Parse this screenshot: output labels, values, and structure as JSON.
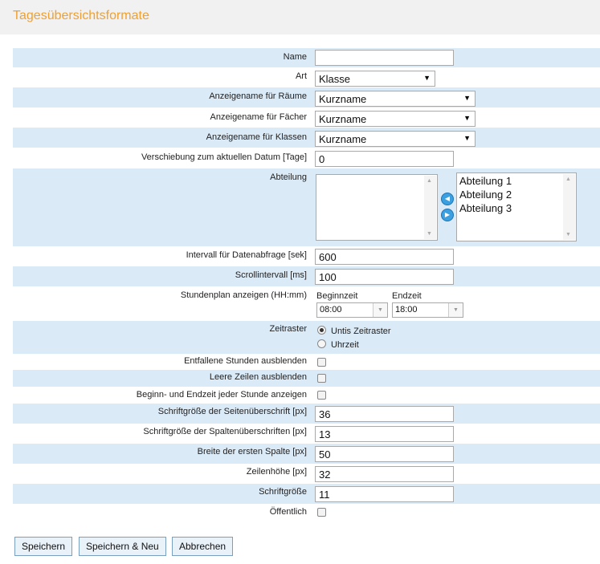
{
  "page": {
    "title": "Tagesübersichtsformate"
  },
  "fields": {
    "name": {
      "label": "Name",
      "value": ""
    },
    "art": {
      "label": "Art",
      "value": "Klasse"
    },
    "raeume": {
      "label": "Anzeigename für Räume",
      "value": "Kurzname"
    },
    "faecher": {
      "label": "Anzeigename für Fächer",
      "value": "Kurzname"
    },
    "klassen": {
      "label": "Anzeigename für Klassen",
      "value": "Kurzname"
    },
    "verschiebung": {
      "label": "Verschiebung zum aktuellen Datum [Tage]",
      "value": "0"
    },
    "abteilung": {
      "label": "Abteilung",
      "selected": [],
      "available": [
        "Abteilung 1",
        "Abteilung 2",
        "Abteilung 3"
      ]
    },
    "intervall": {
      "label": "Intervall für Datenabfrage [sek]",
      "value": "600"
    },
    "scrollintervall": {
      "label": "Scrollintervall [ms]",
      "value": "100"
    },
    "stundenplan": {
      "label": "Stundenplan anzeigen (HH:mm)",
      "begin_label": "Beginnzeit",
      "begin_value": "08:00",
      "end_label": "Endzeit",
      "end_value": "18:00"
    },
    "zeitraster": {
      "label": "Zeitraster",
      "options": [
        "Untis Zeitraster",
        "Uhrzeit"
      ],
      "selected": "Untis Zeitraster"
    },
    "entfallene": {
      "label": "Entfallene Stunden ausblenden",
      "checked": false
    },
    "leere": {
      "label": "Leere Zeilen ausblenden",
      "checked": false
    },
    "beginn_end": {
      "label": "Beginn- und Endzeit jeder Stunde anzeigen",
      "checked": false
    },
    "schrift_seite": {
      "label": "Schriftgröße der Seitenüberschrift [px]",
      "value": "36"
    },
    "schrift_spalte": {
      "label": "Schriftgröße der Spaltenüberschriften [px]",
      "value": "13"
    },
    "breite": {
      "label": "Breite der ersten Spalte [px]",
      "value": "50"
    },
    "zeilenhoehe": {
      "label": "Zeilenhöhe [px]",
      "value": "32"
    },
    "schriftgroesse": {
      "label": "Schriftgröße",
      "value": "11"
    },
    "oeffentlich": {
      "label": "Öffentlich",
      "checked": false
    }
  },
  "buttons": {
    "save": "Speichern",
    "save_new": "Speichern & Neu",
    "cancel": "Abbrechen"
  },
  "colors": {
    "title": "#f0a030",
    "row_alt": "#dbeaf7",
    "title_bar": "#f1f1f1"
  }
}
